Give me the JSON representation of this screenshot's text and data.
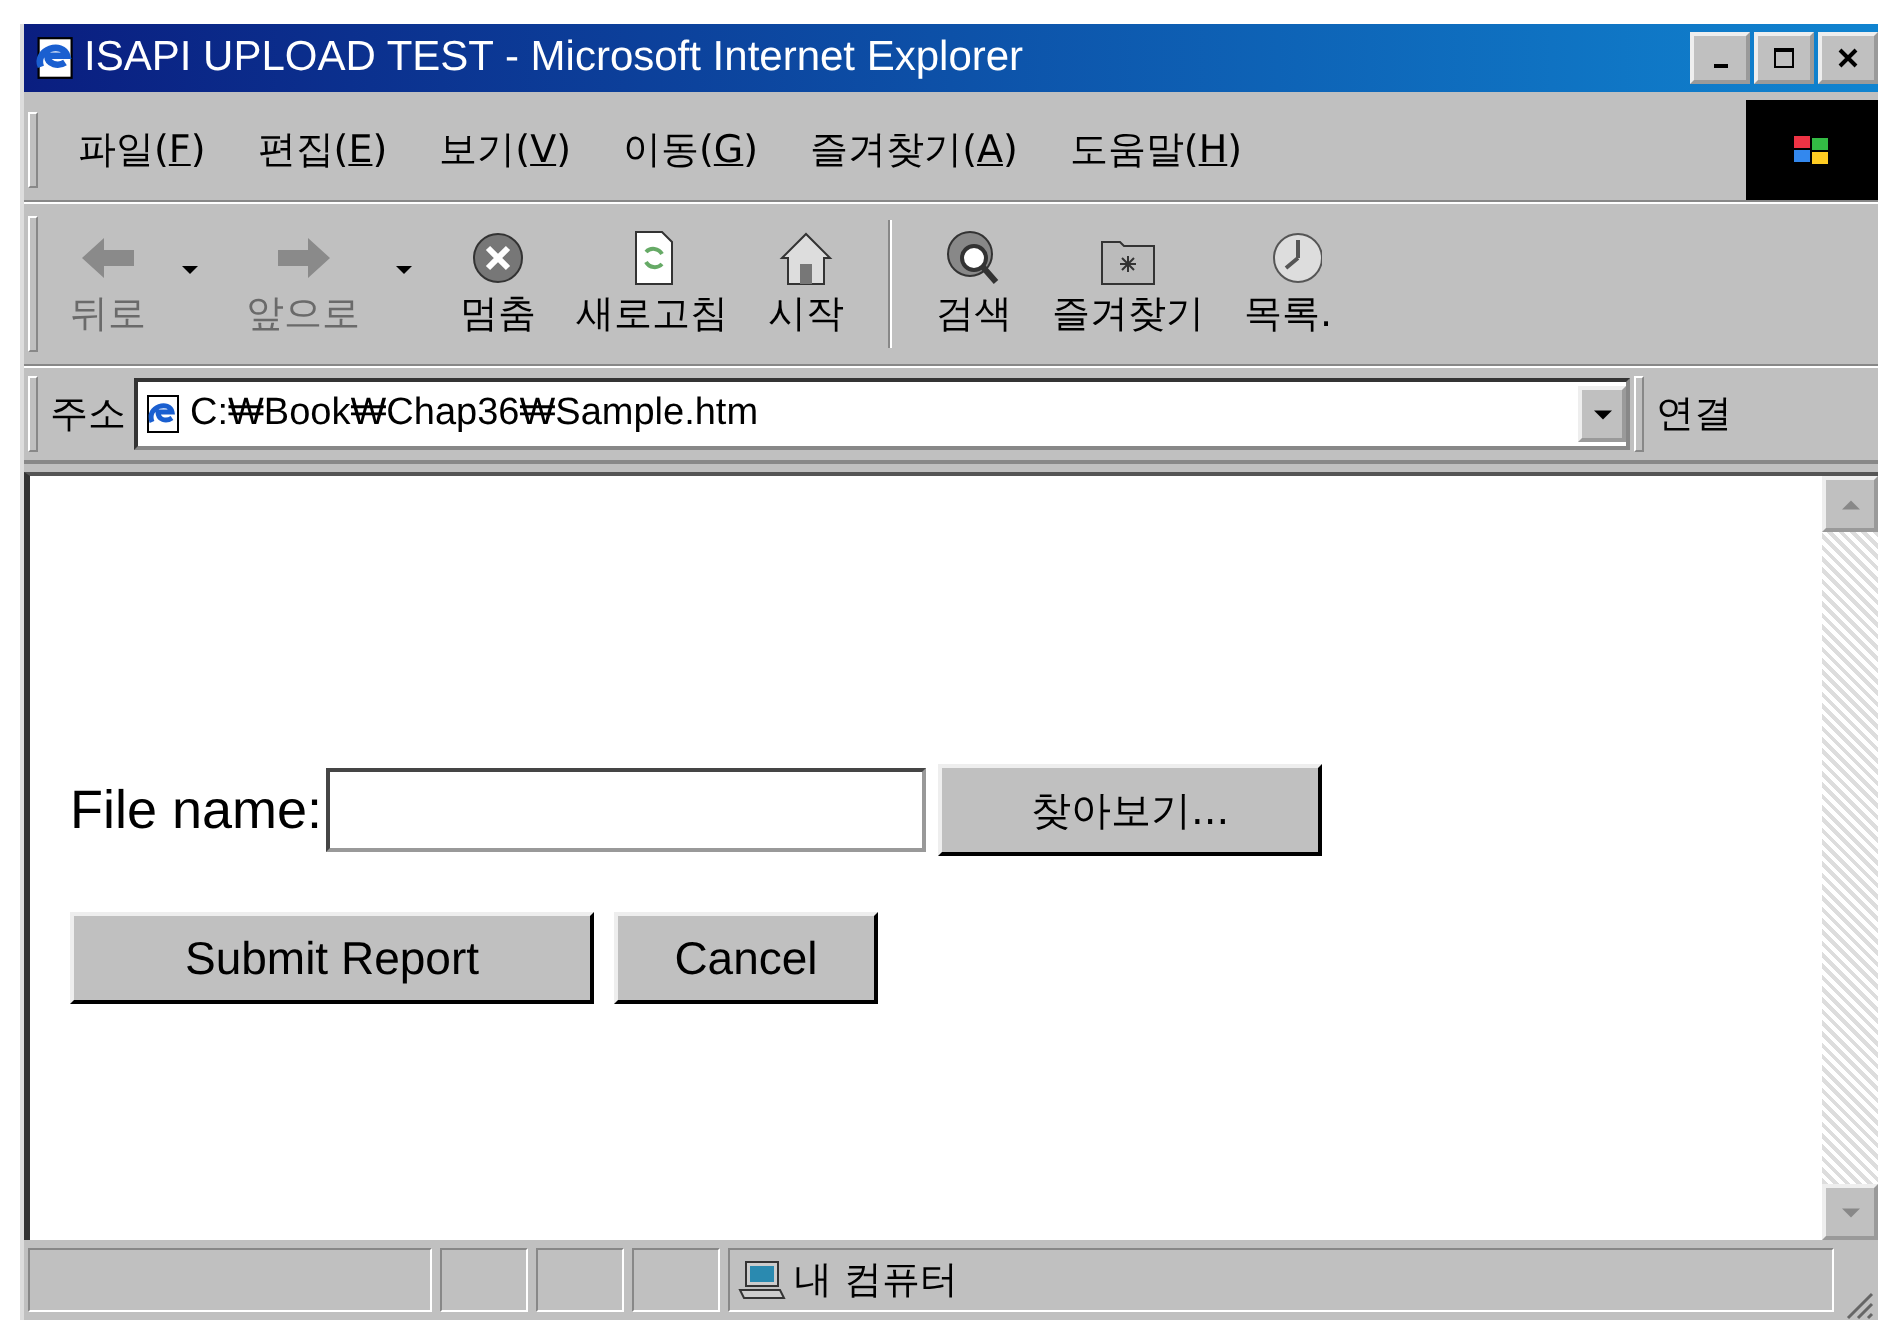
{
  "window": {
    "title": "ISAPI UPLOAD TEST - Microsoft Internet Explorer"
  },
  "menu": [
    {
      "prefix": "파일(",
      "key": "F",
      "suffix": ")"
    },
    {
      "prefix": "편집(",
      "key": "E",
      "suffix": ")"
    },
    {
      "prefix": "보기(",
      "key": "V",
      "suffix": ")"
    },
    {
      "prefix": "이동(",
      "key": "G",
      "suffix": ")"
    },
    {
      "prefix": "즐겨찾기(",
      "key": "A",
      "suffix": ")"
    },
    {
      "prefix": "도움말(",
      "key": "H",
      "suffix": ")"
    }
  ],
  "toolbar": [
    {
      "kind": "back",
      "label": "뒤로",
      "disabled": true,
      "dropdown": true
    },
    {
      "kind": "forward",
      "label": "앞으로",
      "disabled": true,
      "dropdown": true
    },
    {
      "kind": "stop",
      "label": "멈춤",
      "disabled": false,
      "dropdown": false
    },
    {
      "kind": "refresh",
      "label": "새로고침",
      "disabled": false,
      "dropdown": false
    },
    {
      "kind": "home",
      "label": "시작",
      "disabled": false,
      "dropdown": false
    },
    {
      "kind": "separator"
    },
    {
      "kind": "search",
      "label": "검색",
      "disabled": false,
      "dropdown": false
    },
    {
      "kind": "favorites",
      "label": "즐겨찾기",
      "disabled": false,
      "dropdown": false
    },
    {
      "kind": "history",
      "label": "목록.",
      "disabled": false,
      "dropdown": false
    }
  ],
  "address": {
    "label": "주소",
    "value": "C:₩Book₩Chap36₩Sample.htm",
    "links_label": "연결"
  },
  "form": {
    "file_label": "File name:",
    "browse_button": "찾아보기...",
    "buttons": [
      "Submit Report",
      "Cancel"
    ]
  },
  "status_bar": {
    "zone": "내 컴퓨터"
  }
}
